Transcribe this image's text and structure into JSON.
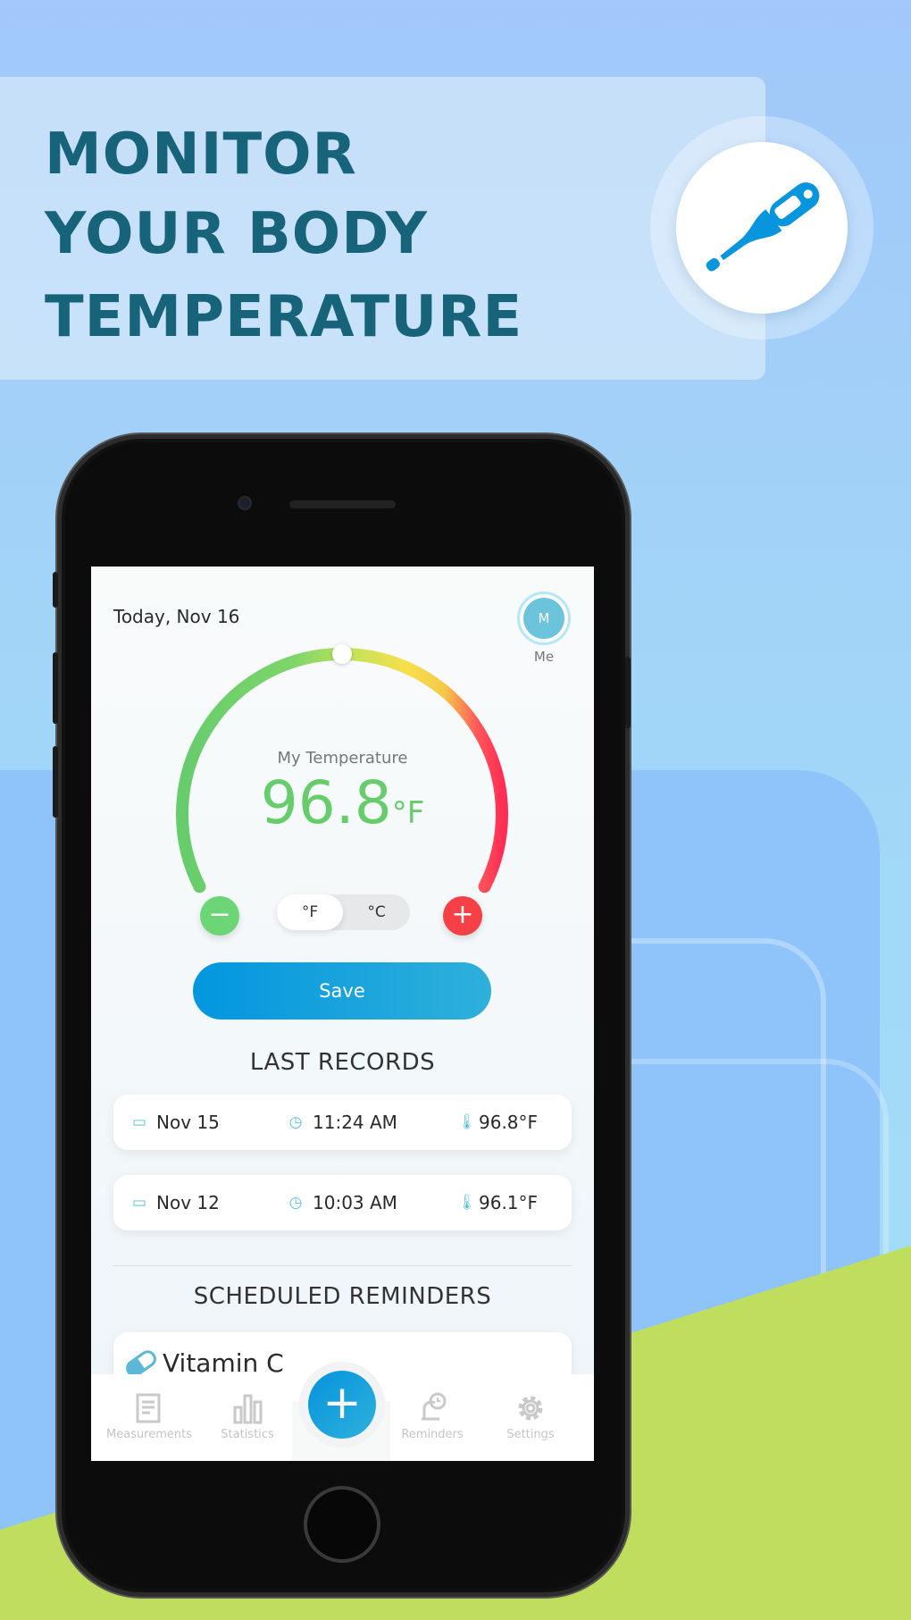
{
  "banner": {
    "lines": [
      "MONITOR",
      "YOUR BODY",
      "TEMPERATURE"
    ],
    "icon": "thermometer-icon"
  },
  "colors": {
    "title": "#17637a",
    "accent": "#0396df",
    "gauge_low": "#66cc6c",
    "gauge_mid": "#f5e04a",
    "gauge_high": "#ff2e55",
    "minus": "#6cd677",
    "plus": "#f64047"
  },
  "screen": {
    "date": "Today, Nov 16",
    "profile": {
      "initial": "M",
      "label": "Me"
    },
    "gauge": {
      "label": "My Temperature",
      "value": "96.8",
      "unit": "°F",
      "level_fraction": 0.5
    },
    "unit_toggle": {
      "options": [
        "°F",
        "°C"
      ],
      "selected": "°F"
    },
    "save_label": "Save",
    "last_records": {
      "title": "LAST RECORDS",
      "rows": [
        {
          "date": "Nov 15",
          "time": "11:24 AM",
          "temp": "96.8°F"
        },
        {
          "date": "Nov 12",
          "time": "10:03 AM",
          "temp": "96.1°F"
        }
      ]
    },
    "reminders": {
      "title": "SCHEDULED REMINDERS",
      "items": [
        {
          "name": "Vitamin C",
          "icon": "pill-icon"
        }
      ]
    },
    "nav": {
      "items": [
        {
          "label": "Measurements",
          "icon": "notes-icon"
        },
        {
          "label": "Statistics",
          "icon": "bar-chart-icon"
        },
        {
          "label": "Reminders",
          "icon": "bell-clock-icon"
        },
        {
          "label": "Settings",
          "icon": "gear-icon"
        }
      ],
      "fab": "+"
    }
  }
}
